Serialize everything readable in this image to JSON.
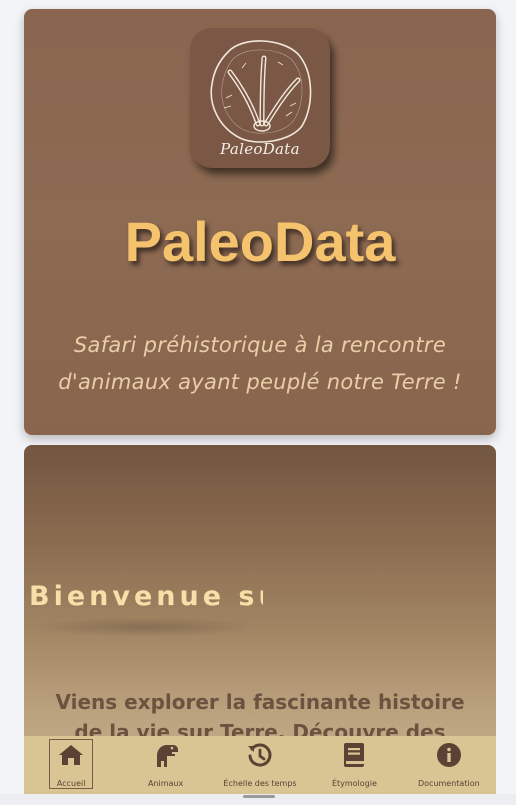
{
  "hero": {
    "logo_caption": "PaleoData",
    "title": "PaleoData",
    "tagline_line1": "Safari préhistorique à la rencontre",
    "tagline_line2": "d'animaux ayant peuplé notre Terre !"
  },
  "welcome": {
    "title": "Bienvenue sur",
    "text_line1": "Viens explorer la fascinante histoire",
    "text_line2": "de la vie sur Terre. Découvre des"
  },
  "nav": {
    "items": [
      {
        "label": "Accueil",
        "icon": "home-icon",
        "active": true
      },
      {
        "label": "Animaux",
        "icon": "dinosaur-icon",
        "active": false
      },
      {
        "label": "Échelle des temps",
        "icon": "history-icon",
        "active": false
      },
      {
        "label": "Étymologie",
        "icon": "book-icon",
        "active": false
      },
      {
        "label": "Documentation",
        "icon": "info-icon",
        "active": false
      }
    ]
  },
  "colors": {
    "hero_bg": "#8a6650",
    "title": "#f5c36d",
    "tagline": "#e9cfa8",
    "nav_bg": "#d9c494",
    "icon": "#5a4234"
  }
}
